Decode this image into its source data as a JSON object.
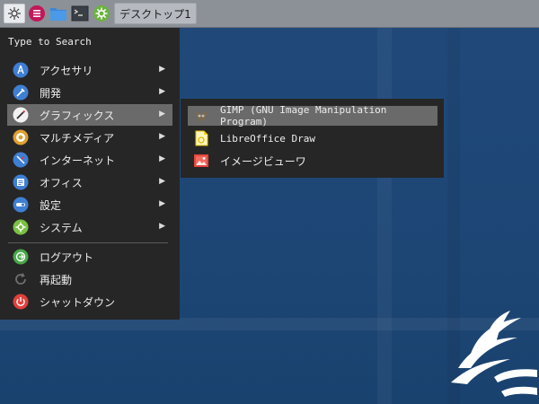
{
  "panel": {
    "workspace_label": "デスクトップ1",
    "icons": [
      "whisker-menu-icon",
      "app-menu-icon",
      "file-manager-icon",
      "terminal-icon",
      "settings-icon"
    ]
  },
  "menu": {
    "search_placeholder": "Type to Search",
    "categories": [
      {
        "label": "アクセサリ",
        "icon": "accessories-icon",
        "color": "#3f7fd3"
      },
      {
        "label": "開発",
        "icon": "development-icon",
        "color": "#3f7fd3"
      },
      {
        "label": "グラフィックス",
        "icon": "graphics-icon",
        "color": "#3f7fd3"
      },
      {
        "label": "マルチメディア",
        "icon": "multimedia-icon",
        "color": "#e0a030"
      },
      {
        "label": "インターネット",
        "icon": "internet-icon",
        "color": "#3f7fd3"
      },
      {
        "label": "オフィス",
        "icon": "office-icon",
        "color": "#3f7fd3"
      },
      {
        "label": "設定",
        "icon": "settings-category-icon",
        "color": "#3f7fd3"
      },
      {
        "label": "システム",
        "icon": "system-icon",
        "color": "#7cc043"
      }
    ],
    "actions": [
      {
        "label": "ログアウト",
        "icon": "logout-icon",
        "color": "#4aa84a"
      },
      {
        "label": "再起動",
        "icon": "restart-icon",
        "color": "#777777"
      },
      {
        "label": "シャットダウン",
        "icon": "shutdown-icon",
        "color": "#e0403c"
      }
    ],
    "arrow": "▶"
  },
  "submenu": {
    "items": [
      {
        "label": "GIMP (GNU Image Manipulation Program)",
        "icon": "gimp-icon"
      },
      {
        "label": "LibreOffice Draw",
        "icon": "libreoffice-draw-icon"
      },
      {
        "label": "イメージビューワ",
        "icon": "image-viewer-icon"
      }
    ]
  },
  "colors": {
    "panel_bg": "#8c9198",
    "menu_bg": "#262626",
    "highlight": "#6a6a6a",
    "desktop": "#1f4a78"
  }
}
